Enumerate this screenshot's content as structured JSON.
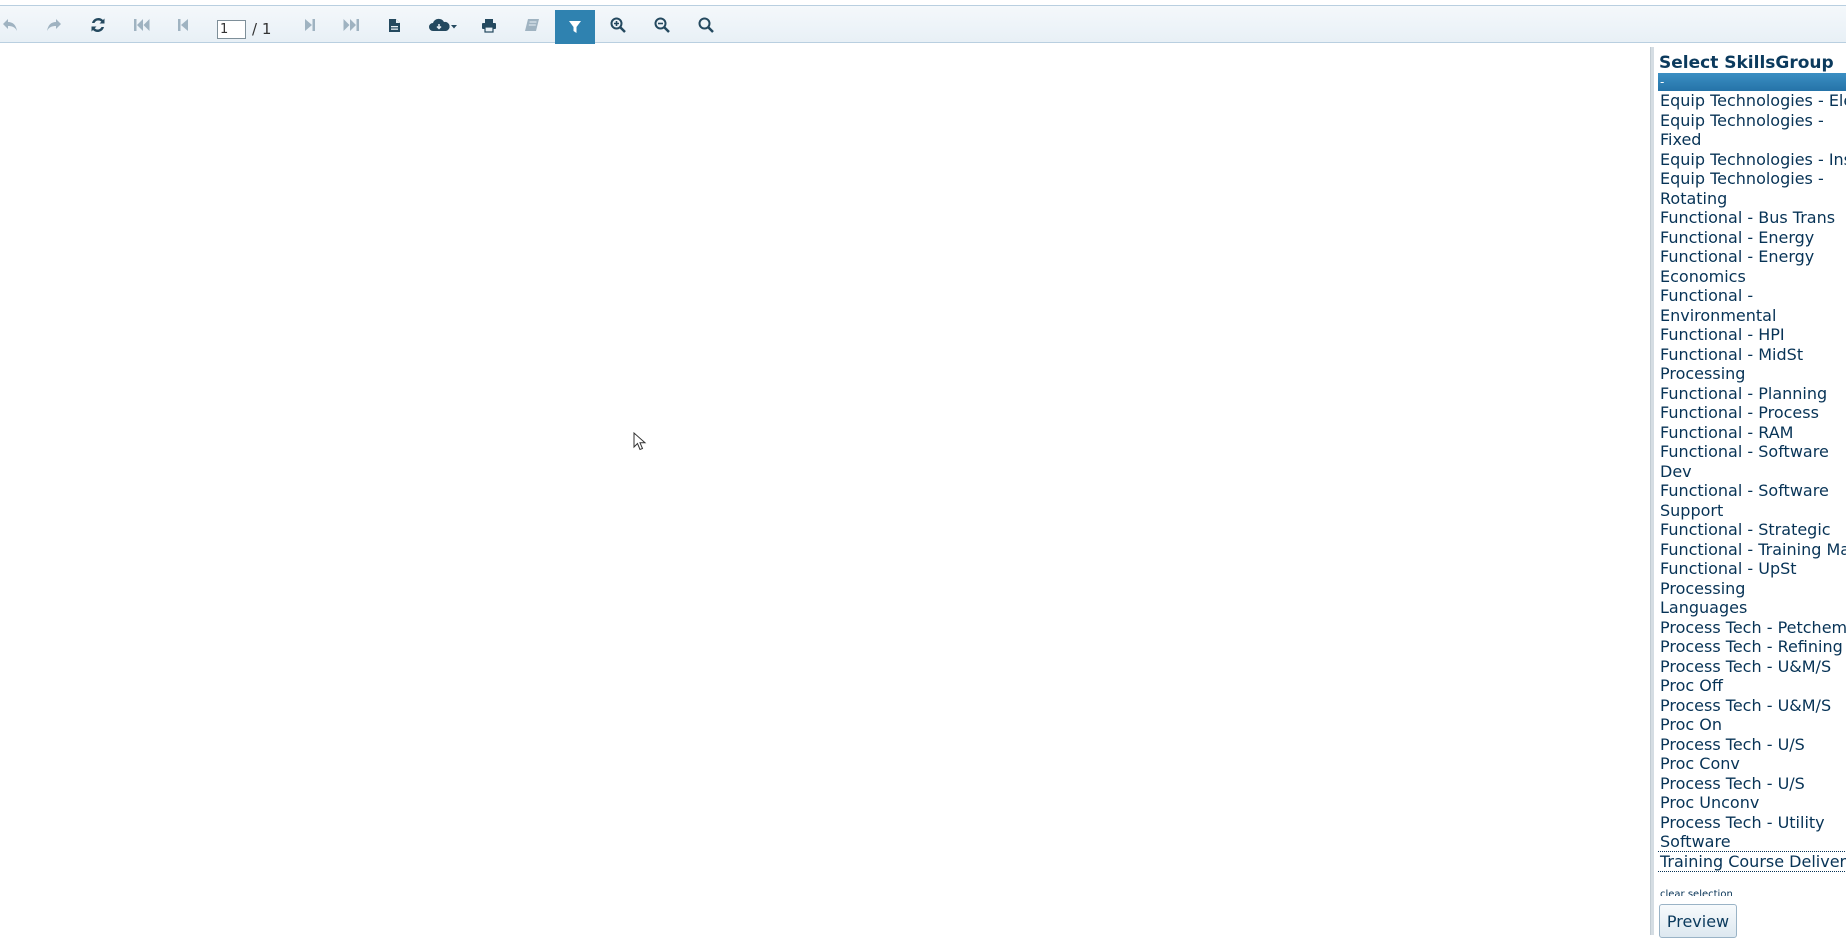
{
  "toolbar": {
    "page_current": "1",
    "page_total": "/ 1",
    "icons": [
      "undo-icon",
      "redo-icon",
      "refresh-icon",
      "first-page-icon",
      "previous-page-icon",
      "next-page-icon",
      "last-page-icon",
      "document-map-icon",
      "export-icon",
      "print-icon",
      "print-layout-icon",
      "parameters-icon",
      "zoom-in-icon",
      "zoom-out-icon",
      "search-icon"
    ],
    "accent_color": "#2f82b0",
    "icon_color": "#24495f",
    "disabled_icon_color": "#9fb3c1"
  },
  "params_panel": {
    "title": "Select SkillsGroup",
    "selected_item": "-",
    "items": [
      "Equip Technologies - Electrical",
      "Equip Technologies - Fixed",
      "Equip Technologies - Instrumentation",
      "Equip Technologies - Rotating",
      "Functional - Bus Trans",
      "Functional - Energy",
      "Functional - Energy Economics",
      "Functional - Environmental",
      "Functional - HPI",
      "Functional - MidSt Processing",
      "Functional - Planning",
      "Functional - Process",
      "Functional - RAM",
      "Functional - Software Dev",
      "Functional - Software Support",
      "Functional - Strategic",
      "Functional - Training Mat Dev",
      "Functional - UpSt Processing",
      "Languages",
      "Process Tech - Petchem",
      "Process Tech - Refining",
      "Process Tech - U&M/S Proc Off",
      "Process Tech - U&M/S Proc On",
      "Process Tech - U/S Proc Conv",
      "Process Tech - U/S Proc Unconv",
      "Process Tech - Utility Software",
      "Training Course Delivery"
    ],
    "clear_selection": "clear selection",
    "preview_label": "Preview",
    "selection_color": "#2573a8",
    "text_color": "#073356"
  }
}
